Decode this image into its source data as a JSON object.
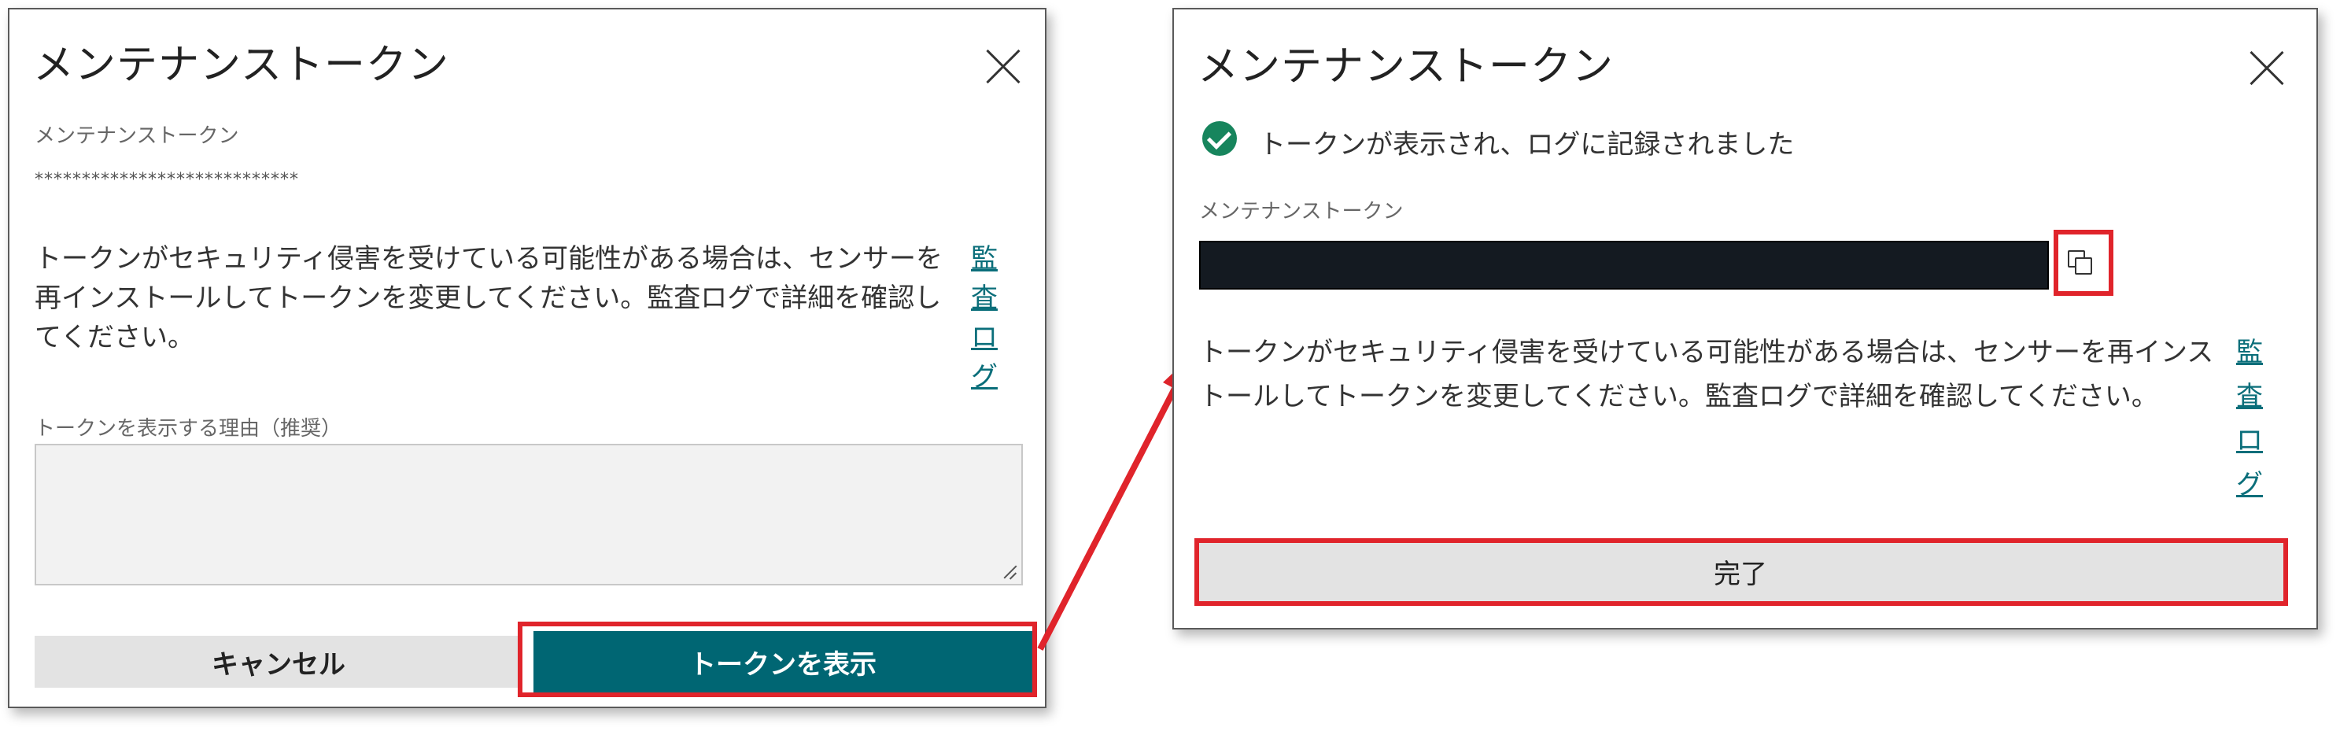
{
  "left_dialog": {
    "title": "メンテナンストークン",
    "token_label": "メンテナンストークン",
    "token_masked": "****************************",
    "warning_text": "トークンがセキュリティ侵害を受けている可能性がある場合は、センサーを再インストールしてトークンを変更してください。監査ログで詳細を確認してください。",
    "audit_log_link": "監査ログ",
    "reason_label": "トークンを表示する理由（推奨）",
    "reason_value": "",
    "cancel_button": "キャンセル",
    "show_token_button": "トークンを表示"
  },
  "right_dialog": {
    "title": "メンテナンストークン",
    "success_message": "トークンが表示され、ログに記録されました",
    "token_label": "メンテナンストークン",
    "warning_text": "トークンがセキュリティ侵害を受けている可能性がある場合は、センサーを再インストールしてトークンを変更してください。監査ログで詳細を確認してください。",
    "audit_log_link": "監査ログ",
    "done_button": "完了"
  },
  "icons": {
    "close": "close-icon",
    "success": "check-circle-icon",
    "copy": "copy-icon"
  },
  "colors": {
    "primary_button": "#006673",
    "highlight_box": "#e0242b",
    "success": "#17855d",
    "link": "#0a6e7a"
  }
}
